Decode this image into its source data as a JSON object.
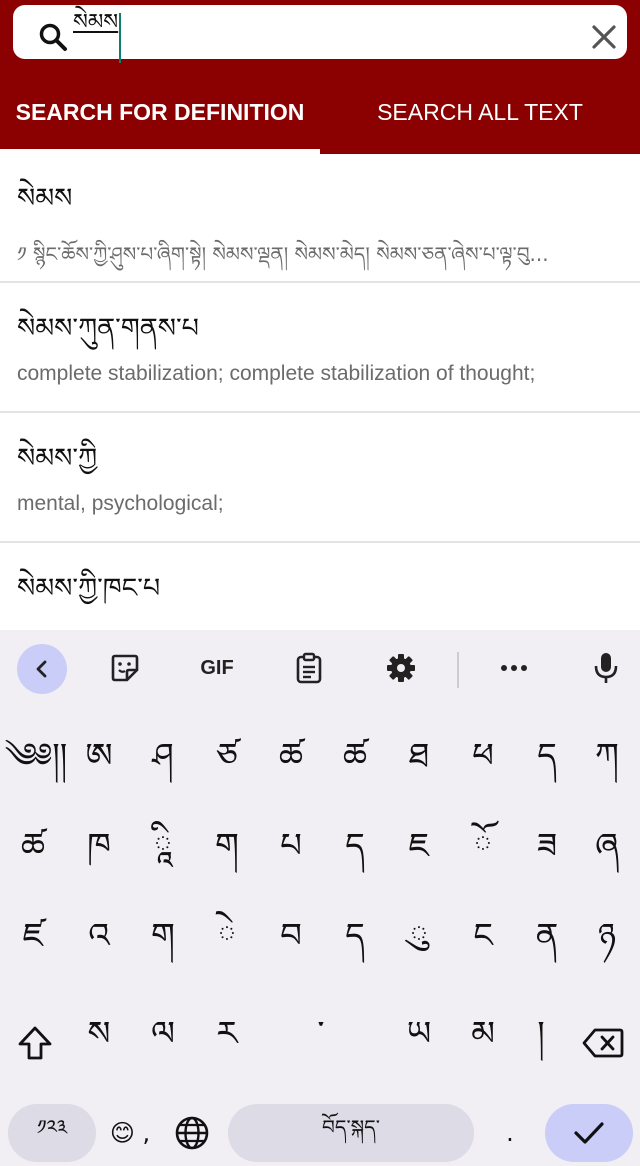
{
  "search": {
    "query": "སེམས"
  },
  "tabs": {
    "definition": "SEARCH FOR DEFINITION",
    "all_text": "SEARCH ALL TEXT"
  },
  "results": [
    {
      "term": "སེམས",
      "definition": "༡ སྙིང་ཆོས་ཀྱི་ཤུས་པ་ཞིག་སྟེ། སེམས་ལྡན། སེམས་མེད། སེམས་ཅན་ཞེས་པ་ལྟ་བུ..."
    },
    {
      "term": "སེམས་ཀུན་གནས་པ",
      "definition": "complete stabilization; complete stabilization of thought;"
    },
    {
      "term": "སེམས་ཀྱི",
      "definition": "mental, psychological;"
    },
    {
      "term": "སེམས་ཀྱི་ཁང་པ",
      "definition": ""
    }
  ],
  "keyboard": {
    "toolbar": {
      "gif": "GIF"
    },
    "row1": [
      "༄༅།།",
      "ཨ",
      "ཤ",
      "ཙ",
      "ཚ",
      "ཚ",
      "ཐ",
      "ཕ",
      "ད",
      "ཀ"
    ],
    "row2": [
      "ཚ",
      "ཁ",
      "ཱི",
      "ག",
      "པ",
      "ད",
      "ཇ",
      "ོ",
      "ཟ",
      "ཞ"
    ],
    "row3": [
      "ཛ",
      "འ",
      "ག",
      "ེ",
      "བ",
      "ད",
      "ུ",
      "ང",
      "ན",
      "ཉ"
    ],
    "row4": [
      "ས",
      "ལ",
      "ར",
      "་",
      "ཡ",
      "མ",
      "།"
    ],
    "sym_label": "༡༢༣",
    "emoji_comma": "😊 ,",
    "space_label": "བོད་སྐད་",
    "period": "."
  },
  "colors": {
    "header": "#8b0000",
    "caret": "#0b7e6e",
    "accent_key": "#c9cdf7"
  }
}
